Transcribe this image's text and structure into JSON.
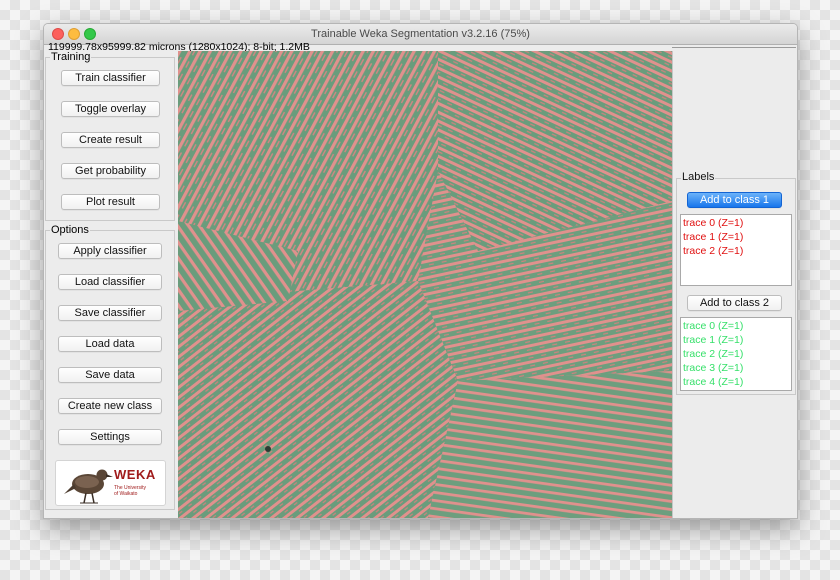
{
  "colors": {
    "class1": "#e01010",
    "class2": "#36e06a",
    "stripe_red": "#e48e8b",
    "stripe_green": "#64a07a"
  },
  "window": {
    "title": "Trainable Weka Segmentation v3.2.16 (75%)",
    "image_info": "119999.78x95999.82 microns (1280x1024); 8-bit; 1.2MB"
  },
  "training": {
    "title": "Training",
    "buttons": [
      "Train classifier",
      "Toggle overlay",
      "Create result",
      "Get probability",
      "Plot result"
    ]
  },
  "options": {
    "title": "Options",
    "buttons": [
      "Apply classifier",
      "Load classifier",
      "Save classifier",
      "Load data",
      "Save data",
      "Create new class",
      "Settings"
    ]
  },
  "logo": {
    "word": "WEKA",
    "sub": "The University\nof Waikato"
  },
  "labels": {
    "title": "Labels",
    "class1_button": "Add to class 1",
    "class2_button": "Add to class 2",
    "class1_traces": [
      "trace 0 (Z=1)",
      "trace 1 (Z=1)",
      "trace 2 (Z=1)"
    ],
    "class2_traces": [
      "trace 0 (Z=1)",
      "trace 1 (Z=1)",
      "trace 2 (Z=1)",
      "trace 3 (Z=1)",
      "trace 4 (Z=1)"
    ]
  }
}
